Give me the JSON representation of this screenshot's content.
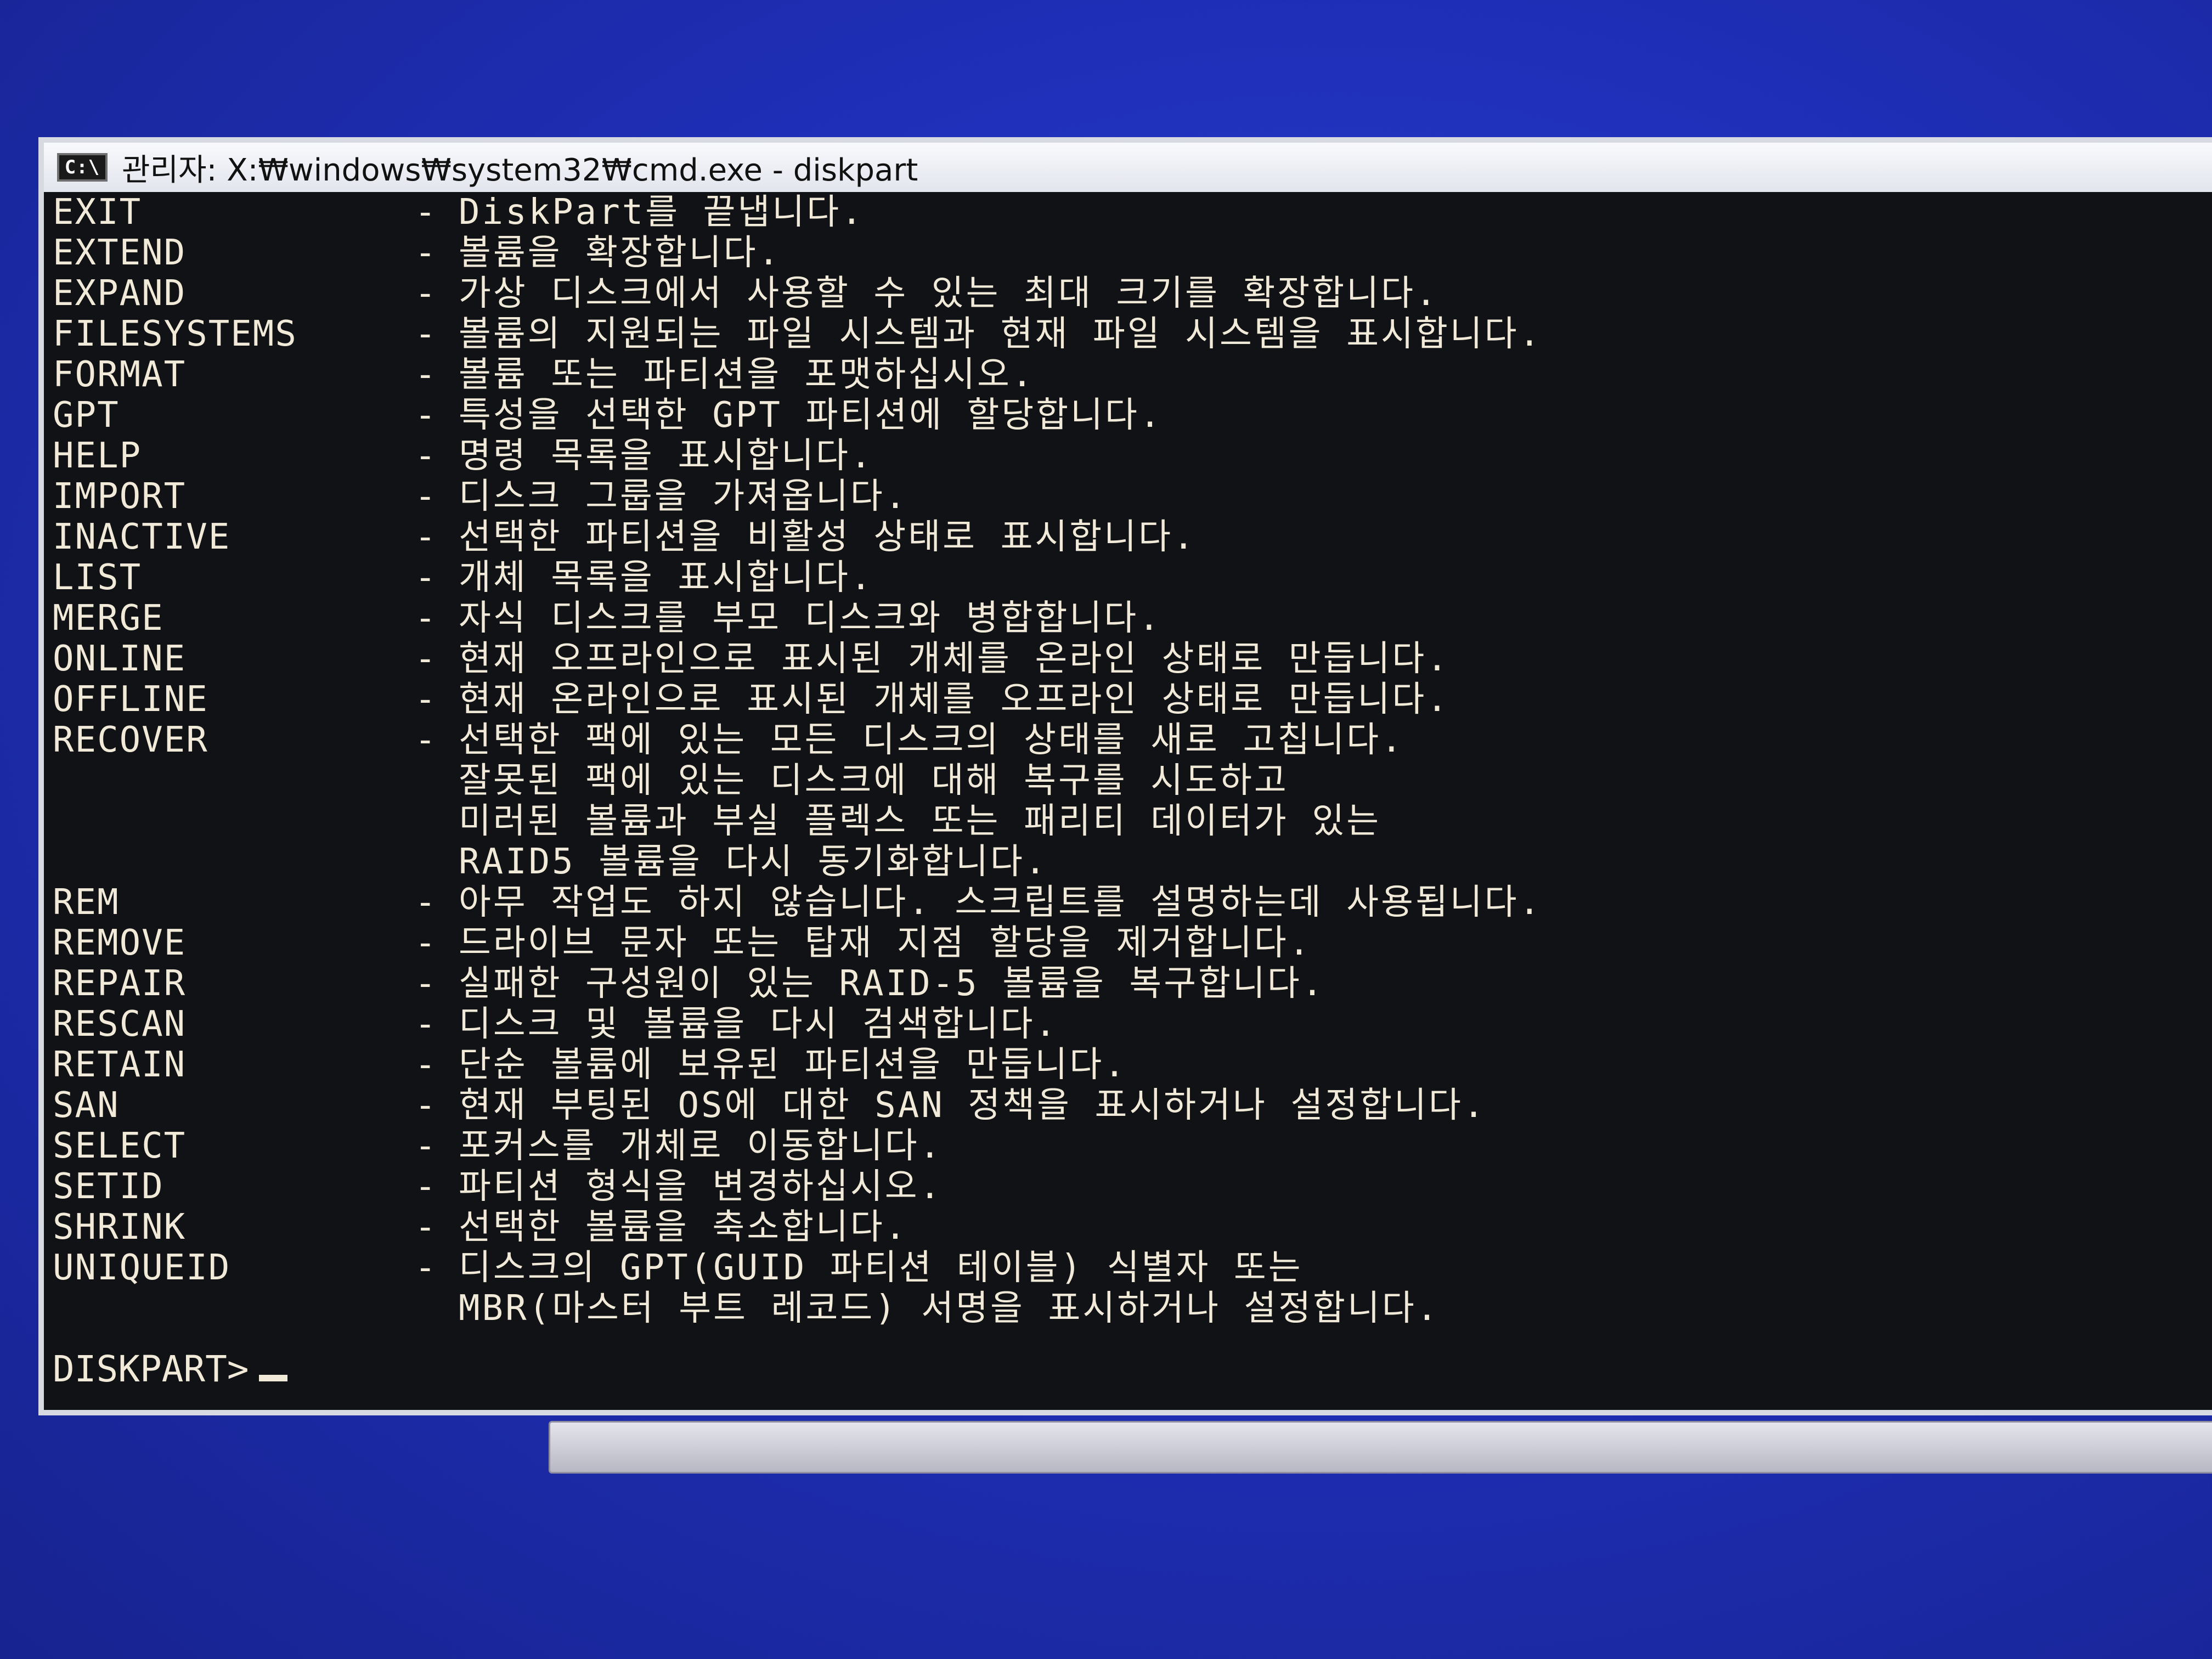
{
  "window": {
    "icon_label": "C:\\",
    "title": "관리자: X:₩windows₩system32₩cmd.exe - diskpart"
  },
  "commands": [
    {
      "name": "EXIT",
      "desc": "DiskPart를 끝냅니다."
    },
    {
      "name": "EXTEND",
      "desc": "볼륨을 확장합니다."
    },
    {
      "name": "EXPAND",
      "desc": "가상 디스크에서 사용할 수 있는 최대 크기를 확장합니다."
    },
    {
      "name": "FILESYSTEMS",
      "desc": "볼륨의 지원되는 파일 시스템과 현재 파일 시스템을 표시합니다."
    },
    {
      "name": "FORMAT",
      "desc": "볼륨 또는 파티션을 포맷하십시오."
    },
    {
      "name": "GPT",
      "desc": "특성을 선택한 GPT 파티션에 할당합니다."
    },
    {
      "name": "HELP",
      "desc": "명령 목록을 표시합니다."
    },
    {
      "name": "IMPORT",
      "desc": "디스크 그룹을 가져옵니다."
    },
    {
      "name": "INACTIVE",
      "desc": "선택한 파티션을 비활성 상태로 표시합니다."
    },
    {
      "name": "LIST",
      "desc": "개체 목록을 표시합니다."
    },
    {
      "name": "MERGE",
      "desc": "자식 디스크를 부모 디스크와 병합합니다."
    },
    {
      "name": "ONLINE",
      "desc": "현재 오프라인으로 표시된 개체를 온라인 상태로 만듭니다."
    },
    {
      "name": "OFFLINE",
      "desc": "현재 온라인으로 표시된 개체를 오프라인 상태로 만듭니다."
    },
    {
      "name": "RECOVER",
      "desc": "선택한 팩에 있는 모든 디스크의 상태를 새로 고칩니다."
    },
    {
      "name": "",
      "desc": "잘못된 팩에 있는 디스크에 대해 복구를 시도하고"
    },
    {
      "name": "",
      "desc": "미러된 볼륨과 부실 플렉스 또는 패리티 데이터가 있는"
    },
    {
      "name": "",
      "desc": "RAID5 볼륨을 다시 동기화합니다."
    },
    {
      "name": "REM",
      "desc": "아무 작업도 하지 않습니다. 스크립트를 설명하는데 사용됩니다."
    },
    {
      "name": "REMOVE",
      "desc": "드라이브 문자 또는 탑재 지점 할당을 제거합니다."
    },
    {
      "name": "REPAIR",
      "desc": "실패한 구성원이 있는 RAID-5 볼륨을 복구합니다."
    },
    {
      "name": "RESCAN",
      "desc": "디스크 및 볼륨을 다시 검색합니다."
    },
    {
      "name": "RETAIN",
      "desc": "단순 볼륨에 보유된 파티션을 만듭니다."
    },
    {
      "name": "SAN",
      "desc": "현재 부팅된 OS에 대한 SAN 정책을 표시하거나 설정합니다."
    },
    {
      "name": "SELECT",
      "desc": "포커스를 개체로 이동합니다."
    },
    {
      "name": "SETID",
      "desc": "파티션 형식을 변경하십시오."
    },
    {
      "name": "SHRINK",
      "desc": "선택한 볼륨을 축소합니다."
    },
    {
      "name": "UNIQUEID",
      "desc": "디스크의 GPT(GUID 파티션 테이블) 식별자 또는"
    },
    {
      "name": "",
      "desc": "MBR(마스터 부트 레코드) 서명을 표시하거나 설정합니다."
    }
  ],
  "prompt": "DISKPART>"
}
